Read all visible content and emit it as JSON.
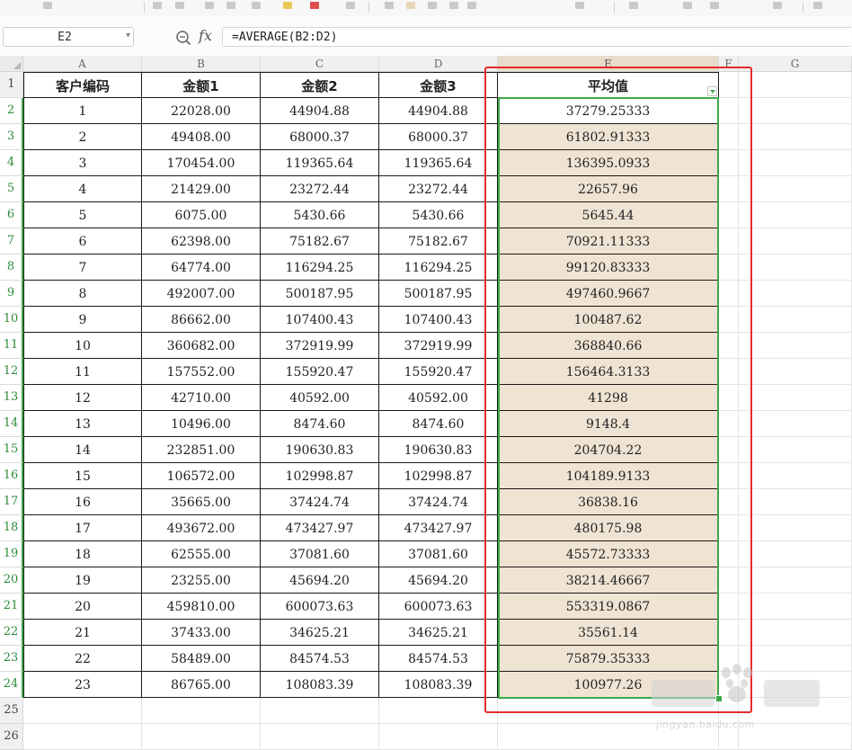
{
  "name_box": "E2",
  "formula": "=AVERAGE(B2:D2)",
  "columns": [
    "A",
    "B",
    "C",
    "D",
    "E",
    "F",
    "G"
  ],
  "headers": [
    "客户编码",
    "金额1",
    "金额2",
    "金额3",
    "平均值"
  ],
  "rows": [
    [
      "1",
      "22028.00",
      "44904.88",
      "44904.88",
      "37279.25333"
    ],
    [
      "2",
      "49408.00",
      "68000.37",
      "68000.37",
      "61802.91333"
    ],
    [
      "3",
      "170454.00",
      "119365.64",
      "119365.64",
      "136395.0933"
    ],
    [
      "4",
      "21429.00",
      "23272.44",
      "23272.44",
      "22657.96"
    ],
    [
      "5",
      "6075.00",
      "5430.66",
      "5430.66",
      "5645.44"
    ],
    [
      "6",
      "62398.00",
      "75182.67",
      "75182.67",
      "70921.11333"
    ],
    [
      "7",
      "64774.00",
      "116294.25",
      "116294.25",
      "99120.83333"
    ],
    [
      "8",
      "492007.00",
      "500187.95",
      "500187.95",
      "497460.9667"
    ],
    [
      "9",
      "86662.00",
      "107400.43",
      "107400.43",
      "100487.62"
    ],
    [
      "10",
      "360682.00",
      "372919.99",
      "372919.99",
      "368840.66"
    ],
    [
      "11",
      "157552.00",
      "155920.47",
      "155920.47",
      "156464.3133"
    ],
    [
      "12",
      "42710.00",
      "40592.00",
      "40592.00",
      "41298"
    ],
    [
      "13",
      "10496.00",
      "8474.60",
      "8474.60",
      "9148.4"
    ],
    [
      "14",
      "232851.00",
      "190630.83",
      "190630.83",
      "204704.22"
    ],
    [
      "15",
      "106572.00",
      "102998.87",
      "102998.87",
      "104189.9133"
    ],
    [
      "16",
      "35665.00",
      "37424.74",
      "37424.74",
      "36838.16"
    ],
    [
      "17",
      "493672.00",
      "473427.97",
      "473427.97",
      "480175.98"
    ],
    [
      "18",
      "62555.00",
      "37081.60",
      "37081.60",
      "45572.73333"
    ],
    [
      "19",
      "23255.00",
      "45694.20",
      "45694.20",
      "38214.46667"
    ],
    [
      "20",
      "459810.00",
      "600073.63",
      "600073.63",
      "553319.0867"
    ],
    [
      "21",
      "37433.00",
      "34625.21",
      "34625.21",
      "35561.14"
    ],
    [
      "22",
      "58489.00",
      "84574.53",
      "84574.53",
      "75879.35333"
    ],
    [
      "23",
      "86765.00",
      "108083.39",
      "108083.39",
      "100977.26"
    ]
  ],
  "watermark": "jingyan.baidu.com",
  "colors": {
    "selection": "#3ea84a",
    "annotation": "#e52b2b",
    "highlight_fill": "#efe3d3"
  },
  "icons": {
    "zoom": "zoom-icon",
    "fx": "fx-icon",
    "name_box_dropdown": "chevron-down-icon",
    "filter": "filter-dropdown-icon"
  }
}
